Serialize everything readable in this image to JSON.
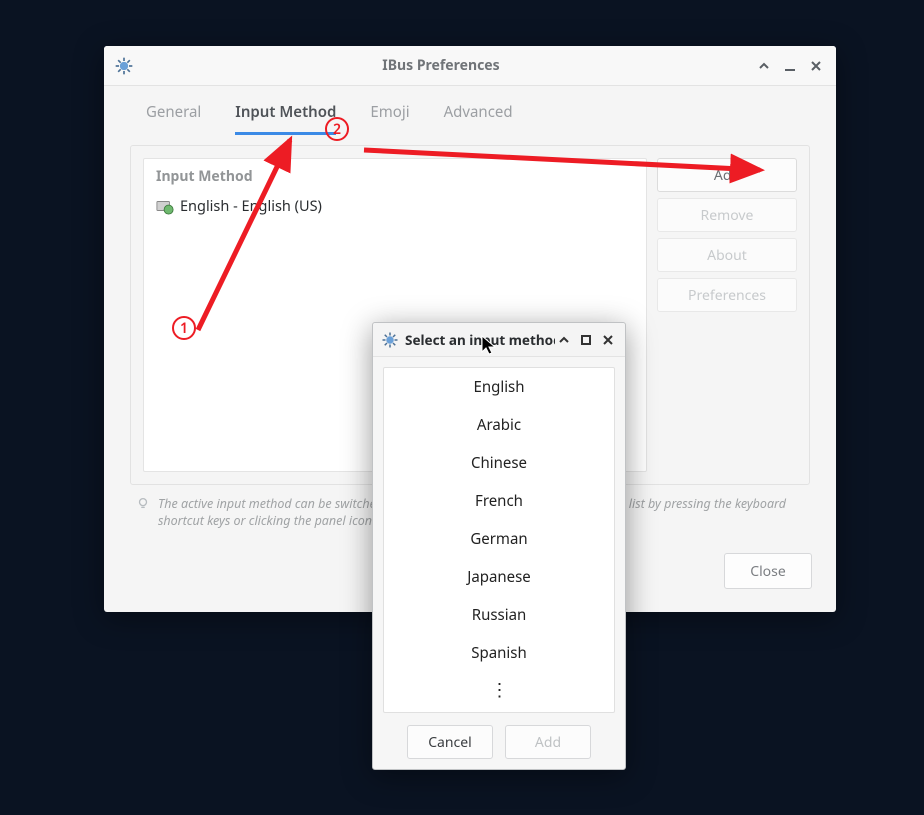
{
  "main_window": {
    "title": "IBus Preferences",
    "tabs": [
      {
        "label": "General"
      },
      {
        "label": "Input Method"
      },
      {
        "label": "Emoji"
      },
      {
        "label": "Advanced"
      }
    ],
    "group_label": "Input Method",
    "input_methods": [
      {
        "label": "English - English (US)"
      }
    ],
    "side_buttons": {
      "add": "Add",
      "remove": "Remove",
      "about": "About",
      "prefs": "Preferences"
    },
    "hint": "The active input method can be switched around from the selected ones in the above list by pressing the keyboard shortcut keys or clicking the panel icon.",
    "close": "Close"
  },
  "dialog": {
    "title": "Select an input method",
    "items": [
      "English",
      "Arabic",
      "Chinese",
      "French",
      "German",
      "Japanese",
      "Russian",
      "Spanish"
    ],
    "more_glyph": "⋮",
    "cancel": "Cancel",
    "add": "Add"
  },
  "annotations": {
    "one": "1",
    "two": "2"
  }
}
